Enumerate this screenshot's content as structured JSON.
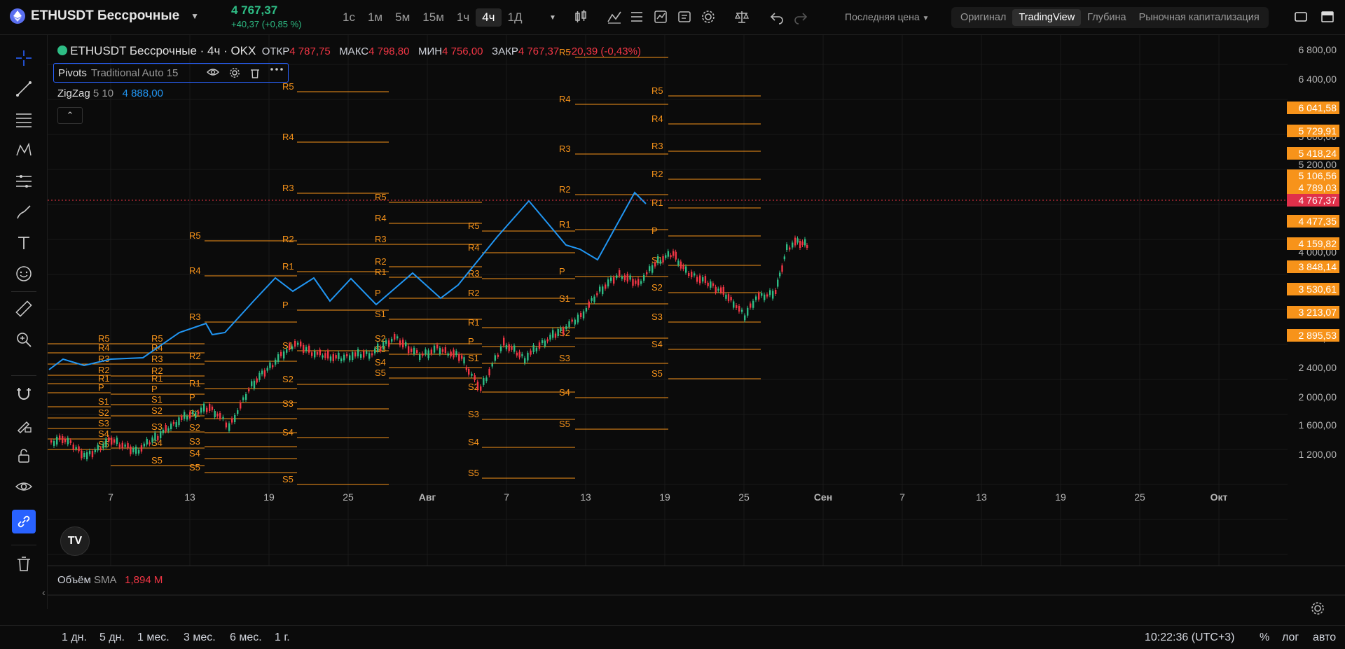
{
  "header": {
    "symbol": "ETHUSDT Бессрочные",
    "last_price": "4 767,37",
    "change": "+40,37 (+0,85 %)",
    "timeframes": [
      {
        "label": "1с",
        "active": false
      },
      {
        "label": "1м",
        "active": false
      },
      {
        "label": "5м",
        "active": false
      },
      {
        "label": "15м",
        "active": false
      },
      {
        "label": "1ч",
        "active": false
      },
      {
        "label": "4ч",
        "active": true
      },
      {
        "label": "1Д",
        "active": false
      }
    ],
    "price_type": "Последняя цена",
    "view_tabs": [
      {
        "label": "Оригинал",
        "active": false
      },
      {
        "label": "TradingView",
        "active": true
      },
      {
        "label": "Глубина",
        "active": false
      },
      {
        "label": "Рыночная капитализация",
        "active": false
      }
    ]
  },
  "legend": {
    "title": "ETHUSDT Бессрочные · 4ч · OKX",
    "open_label": "ОТКР",
    "open": "4 787,75",
    "high_label": "МАКС",
    "high": "4 798,80",
    "low_label": "МИН",
    "low": "4 756,00",
    "close_label": "ЗАКР",
    "close": "4 767,37",
    "change": "-20,39 (-0,43%)"
  },
  "pivots": {
    "name": "Pivots",
    "params": "Traditional Auto 15"
  },
  "zigzag": {
    "name": "ZigZag",
    "params": "5 10",
    "value": "4 888,00"
  },
  "volume": {
    "name": "Объём",
    "ma": "SMA",
    "value": "1,894 M"
  },
  "price_axis": {
    "labels": [
      "6 800,00",
      "6 400,00",
      "5 600,00",
      "5 200,00",
      "4 000,00",
      "2 800,00",
      "2 400,00",
      "2 000,00",
      "1 600,00",
      "1 200,00"
    ],
    "markers": [
      {
        "text": "6 041,58",
        "color": "#f7931a"
      },
      {
        "text": "5 729,91",
        "color": "#f7931a"
      },
      {
        "text": "5 418,24",
        "color": "#f7931a"
      },
      {
        "text": "5 106,56",
        "color": "#f7931a"
      },
      {
        "text": "4 789,03",
        "color": "#f7931a"
      },
      {
        "text": "4 767,37",
        "color": "#e0304a"
      },
      {
        "text": "4 477,35",
        "color": "#f7931a"
      },
      {
        "text": "4 159,82",
        "color": "#f7931a"
      },
      {
        "text": "3 848,14",
        "color": "#f7931a"
      },
      {
        "text": "3 530,61",
        "color": "#f7931a"
      },
      {
        "text": "3 213,07",
        "color": "#f7931a"
      },
      {
        "text": "2 895,53",
        "color": "#f7931a"
      }
    ]
  },
  "time_axis": [
    "7",
    "13",
    "19",
    "25",
    "Авг",
    "7",
    "13",
    "19",
    "25",
    "Сен",
    "7",
    "13",
    "19",
    "25",
    "Окт"
  ],
  "bottom": {
    "ranges": [
      "1 дн.",
      "5 дн.",
      "1 мес.",
      "3 мес.",
      "6 мес.",
      "1 г."
    ],
    "clock": "10:22:36 (UTC+3)",
    "percent": "%",
    "log": "лог",
    "auto": "авто"
  },
  "pivot_labels": [
    "R5",
    "R4",
    "R3",
    "R2",
    "R1",
    "P",
    "S1",
    "S2",
    "S3",
    "S4",
    "S5"
  ],
  "colors": {
    "pivot": "#f7931a",
    "up": "#2ebd85",
    "down": "#f23645",
    "zigzag": "#2196f3",
    "active": "#2962ff"
  },
  "icons": {
    "crosshair": "crosshair-icon",
    "trendline": "trend-line-icon",
    "fib": "fib-icon",
    "pattern": "pattern-icon",
    "forecast": "forecast-icon",
    "brush": "brush-icon",
    "text": "text-icon",
    "emoji": "emoji-icon",
    "ruler": "ruler-icon",
    "zoom": "zoom-in-icon",
    "magnet": "magnet-icon",
    "lock-draw": "lock-drawing-icon",
    "lock": "lock-icon",
    "eye": "eye-icon",
    "link": "link-icon",
    "trash": "trash-icon"
  }
}
